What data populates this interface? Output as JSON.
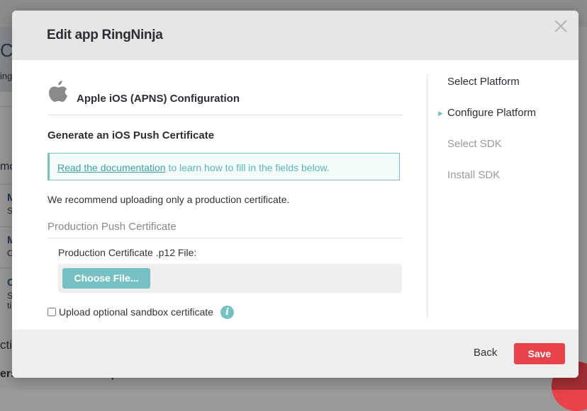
{
  "background": {
    "title_fragment": "Co",
    "sub_fragment": "ing",
    "side_letters": [
      "mo",
      "M",
      "S",
      "M",
      "C",
      "C",
      "S",
      "ti",
      "ctic"
    ],
    "bottom_fragment": "ers who can receive push notifications"
  },
  "modal": {
    "title": "Edit app RingNinja",
    "platform_title": "Apple iOS (APNS) Configuration",
    "section_title": "Generate an iOS Push Certificate",
    "info": {
      "link_text": "Read the documentation",
      "rest_text": " to learn how to fill in the fields below."
    },
    "recommend_text": "We recommend uploading only a production certificate.",
    "production_label": "Production Push Certificate",
    "file_label": "Production Certificate .p12 File:",
    "choose_file_label": "Choose File...",
    "sandbox_label": "Upload optional sandbox certificate",
    "info_icon_glyph": "i",
    "steps": [
      {
        "label": "Select Platform",
        "state": "done"
      },
      {
        "label": "Configure Platform",
        "state": "active"
      },
      {
        "label": "Select SDK",
        "state": "pending"
      },
      {
        "label": "Install SDK",
        "state": "pending"
      }
    ],
    "footer": {
      "back_label": "Back",
      "save_label": "Save"
    }
  },
  "colors": {
    "accent": "#76c1c3",
    "save": "#e8424a",
    "header_bg": "#e6e6e6"
  },
  "icons": [
    "apple-icon",
    "close-icon",
    "info-icon",
    "step-arrow-icon"
  ]
}
